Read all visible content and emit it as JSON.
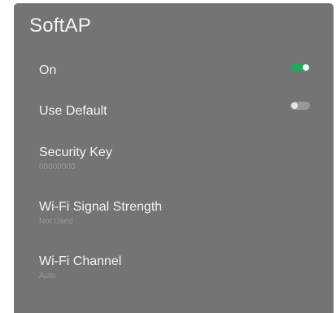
{
  "panel": {
    "title": "SoftAP"
  },
  "items": [
    {
      "label": "On",
      "toggle": true,
      "state": "on"
    },
    {
      "label": "Use Default",
      "toggle": true,
      "state": "off"
    },
    {
      "label": "Security Key",
      "value": "00000000"
    },
    {
      "label": "Wi-Fi Signal Strength",
      "value": "Not Used"
    },
    {
      "label": "Wi-Fi Channel",
      "value": "Auto"
    }
  ],
  "colors": {
    "panel_bg": "#747477",
    "toggle_on": "#29a35a",
    "toggle_off": "#98989b",
    "subtext": "#97979a"
  }
}
